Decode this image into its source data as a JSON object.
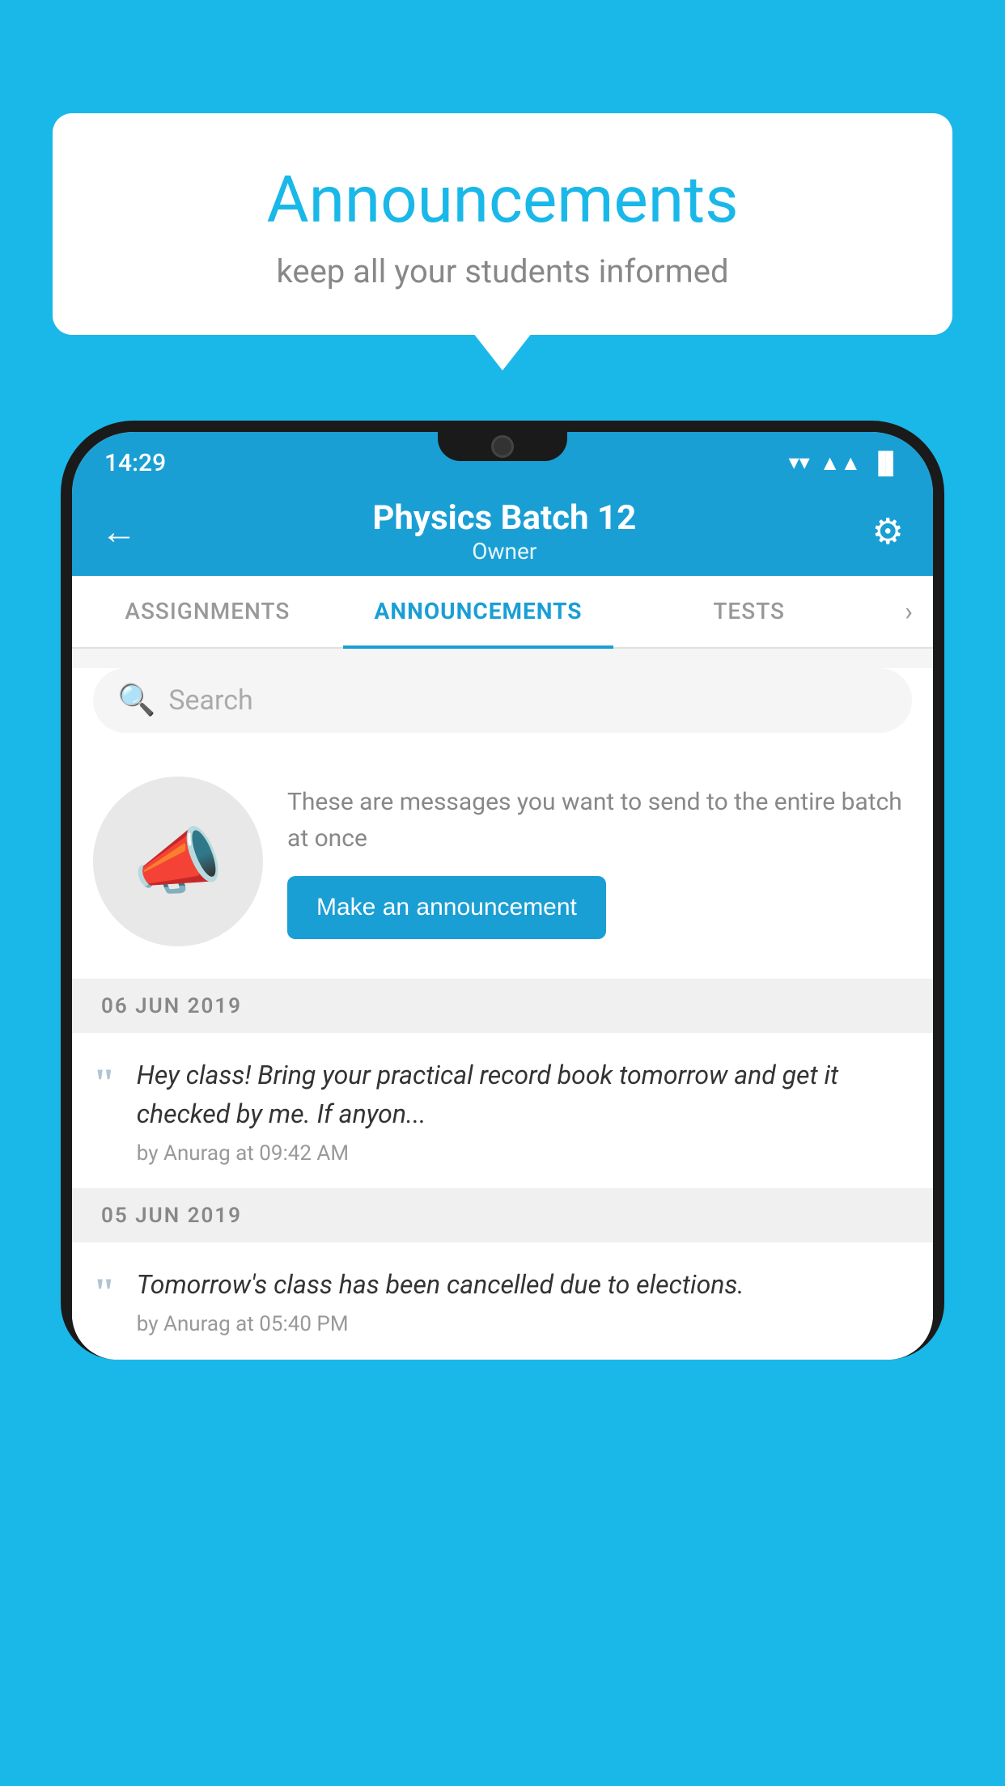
{
  "page": {
    "background_color": "#1ab8e8"
  },
  "speech_bubble": {
    "title": "Announcements",
    "subtitle": "keep all your students informed"
  },
  "status_bar": {
    "time": "14:29",
    "wifi": "▼",
    "signal": "▲",
    "battery": "▐"
  },
  "header": {
    "back_label": "←",
    "title": "Physics Batch 12",
    "subtitle": "Owner",
    "gear_label": "⚙"
  },
  "tabs": [
    {
      "label": "ASSIGNMENTS",
      "active": false
    },
    {
      "label": "ANNOUNCEMENTS",
      "active": true
    },
    {
      "label": "TESTS",
      "active": false
    }
  ],
  "search": {
    "placeholder": "Search"
  },
  "announcement_cta": {
    "description": "These are messages you want to send to the entire batch at once",
    "button_label": "Make an announcement"
  },
  "date_groups": [
    {
      "date": "06  JUN  2019",
      "announcements": [
        {
          "text": "Hey class! Bring your practical record book tomorrow and get it checked by me. If anyon...",
          "meta": "by Anurag at 09:42 AM"
        }
      ]
    },
    {
      "date": "05  JUN  2019",
      "announcements": [
        {
          "text": "Tomorrow's class has been cancelled due to elections.",
          "meta": "by Anurag at 05:40 PM"
        }
      ]
    }
  ]
}
